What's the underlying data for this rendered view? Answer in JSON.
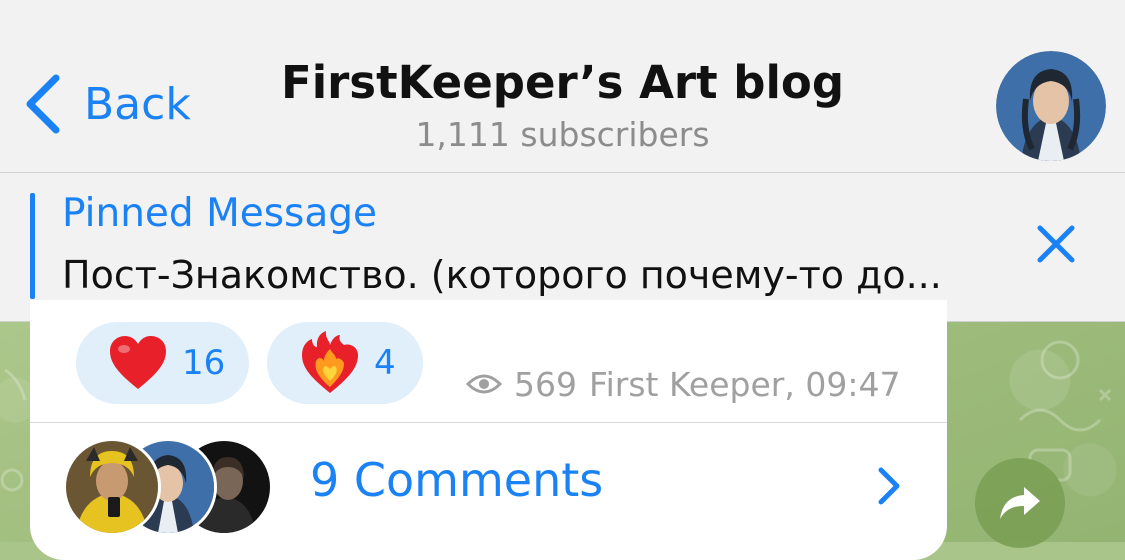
{
  "header": {
    "back_label": "Back",
    "title": "FirstKeeper’s Art blog",
    "subscribers": "1,111 subscribers"
  },
  "pinned": {
    "label": "Pinned Message",
    "text": "Пост-Знакомство. (которого почему-то до..."
  },
  "message": {
    "reactions": [
      {
        "emoji": "heart",
        "count": "16"
      },
      {
        "emoji": "heart-on-fire",
        "count": "4"
      }
    ],
    "views": "569",
    "author_time": "First Keeper, 09:47",
    "comments_label": "9 Comments"
  },
  "colors": {
    "accent": "#1a82f5",
    "header_bg": "#f2f2f2",
    "reaction_bg": "#e1effb",
    "wallpaper": "#a9c58a"
  }
}
